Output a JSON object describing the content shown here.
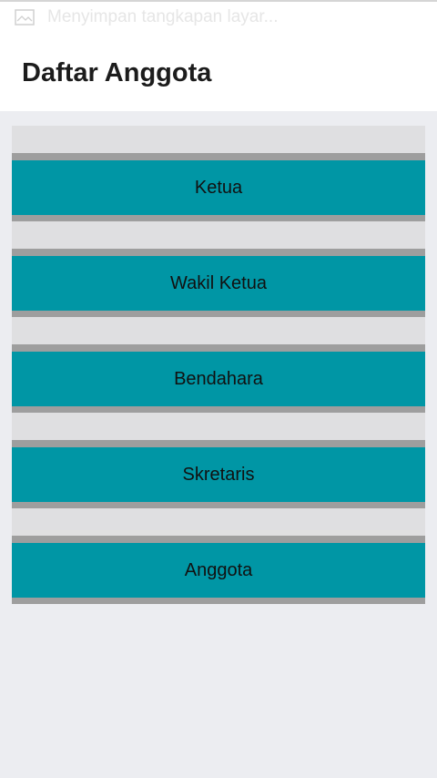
{
  "status_bar": {
    "notification_icon": "screenshot-image-icon",
    "notification_text": "Menyimpan tangkapan layar..."
  },
  "action_bar": {
    "title": "Daftar Anggota"
  },
  "members": [
    {
      "label": "Ketua"
    },
    {
      "label": "Wakil Ketua"
    },
    {
      "label": "Bendahara"
    },
    {
      "label": "Skretaris"
    },
    {
      "label": "Anggota"
    }
  ],
  "colors": {
    "button_background": "#0096a5",
    "button_border": "#9e9e9e",
    "gap_background": "#dfdfe1",
    "page_background": "#ecedf1"
  }
}
